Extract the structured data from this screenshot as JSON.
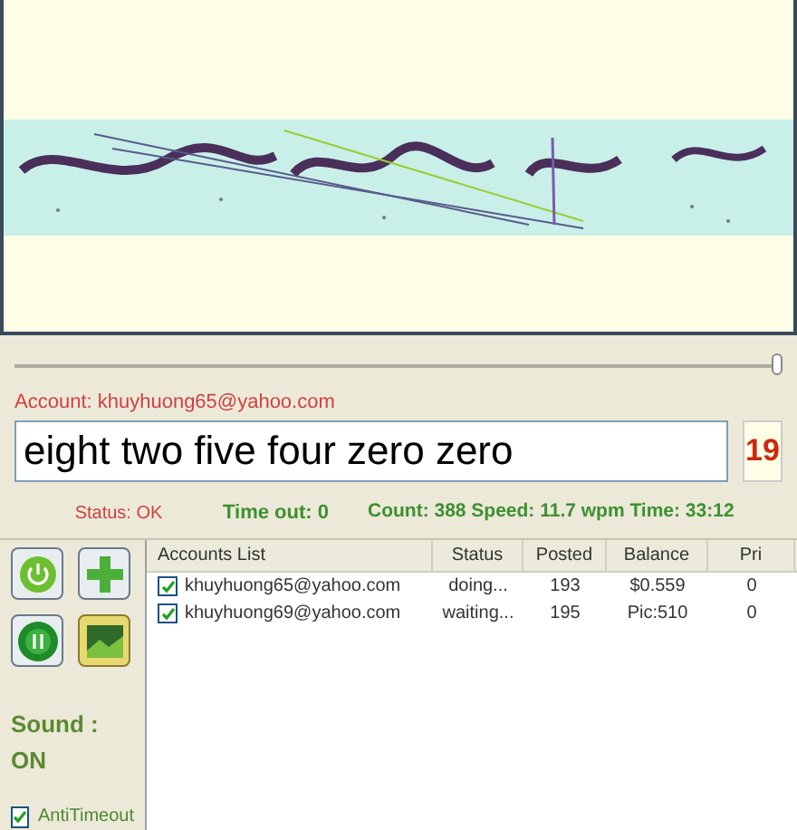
{
  "slider": {
    "level": 1
  },
  "account": "Account: khuyhuong65@yahoo.com",
  "answer": {
    "value": "eight two five four zero zero"
  },
  "counter": "19",
  "status_bar": {
    "status": "Status: OK",
    "timeout": "Time out: 0",
    "stats": "Count: 388 Speed: 11.7 wpm Time: 33:12"
  },
  "sound": "Sound : ON",
  "anti_timeout": {
    "label": "AntiTimeout",
    "checked": true
  },
  "table": {
    "columns": [
      "Accounts List",
      "Status",
      "Posted",
      "Balance",
      "Pri"
    ],
    "rows": [
      {
        "checked": true,
        "cells": [
          "khuyhuong65@yahoo.com",
          "doing...",
          "193",
          "$0.559",
          "0"
        ]
      },
      {
        "checked": true,
        "cells": [
          "khuyhuong69@yahoo.com",
          "waiting...",
          "195",
          "Pic:510",
          "0"
        ]
      }
    ]
  }
}
